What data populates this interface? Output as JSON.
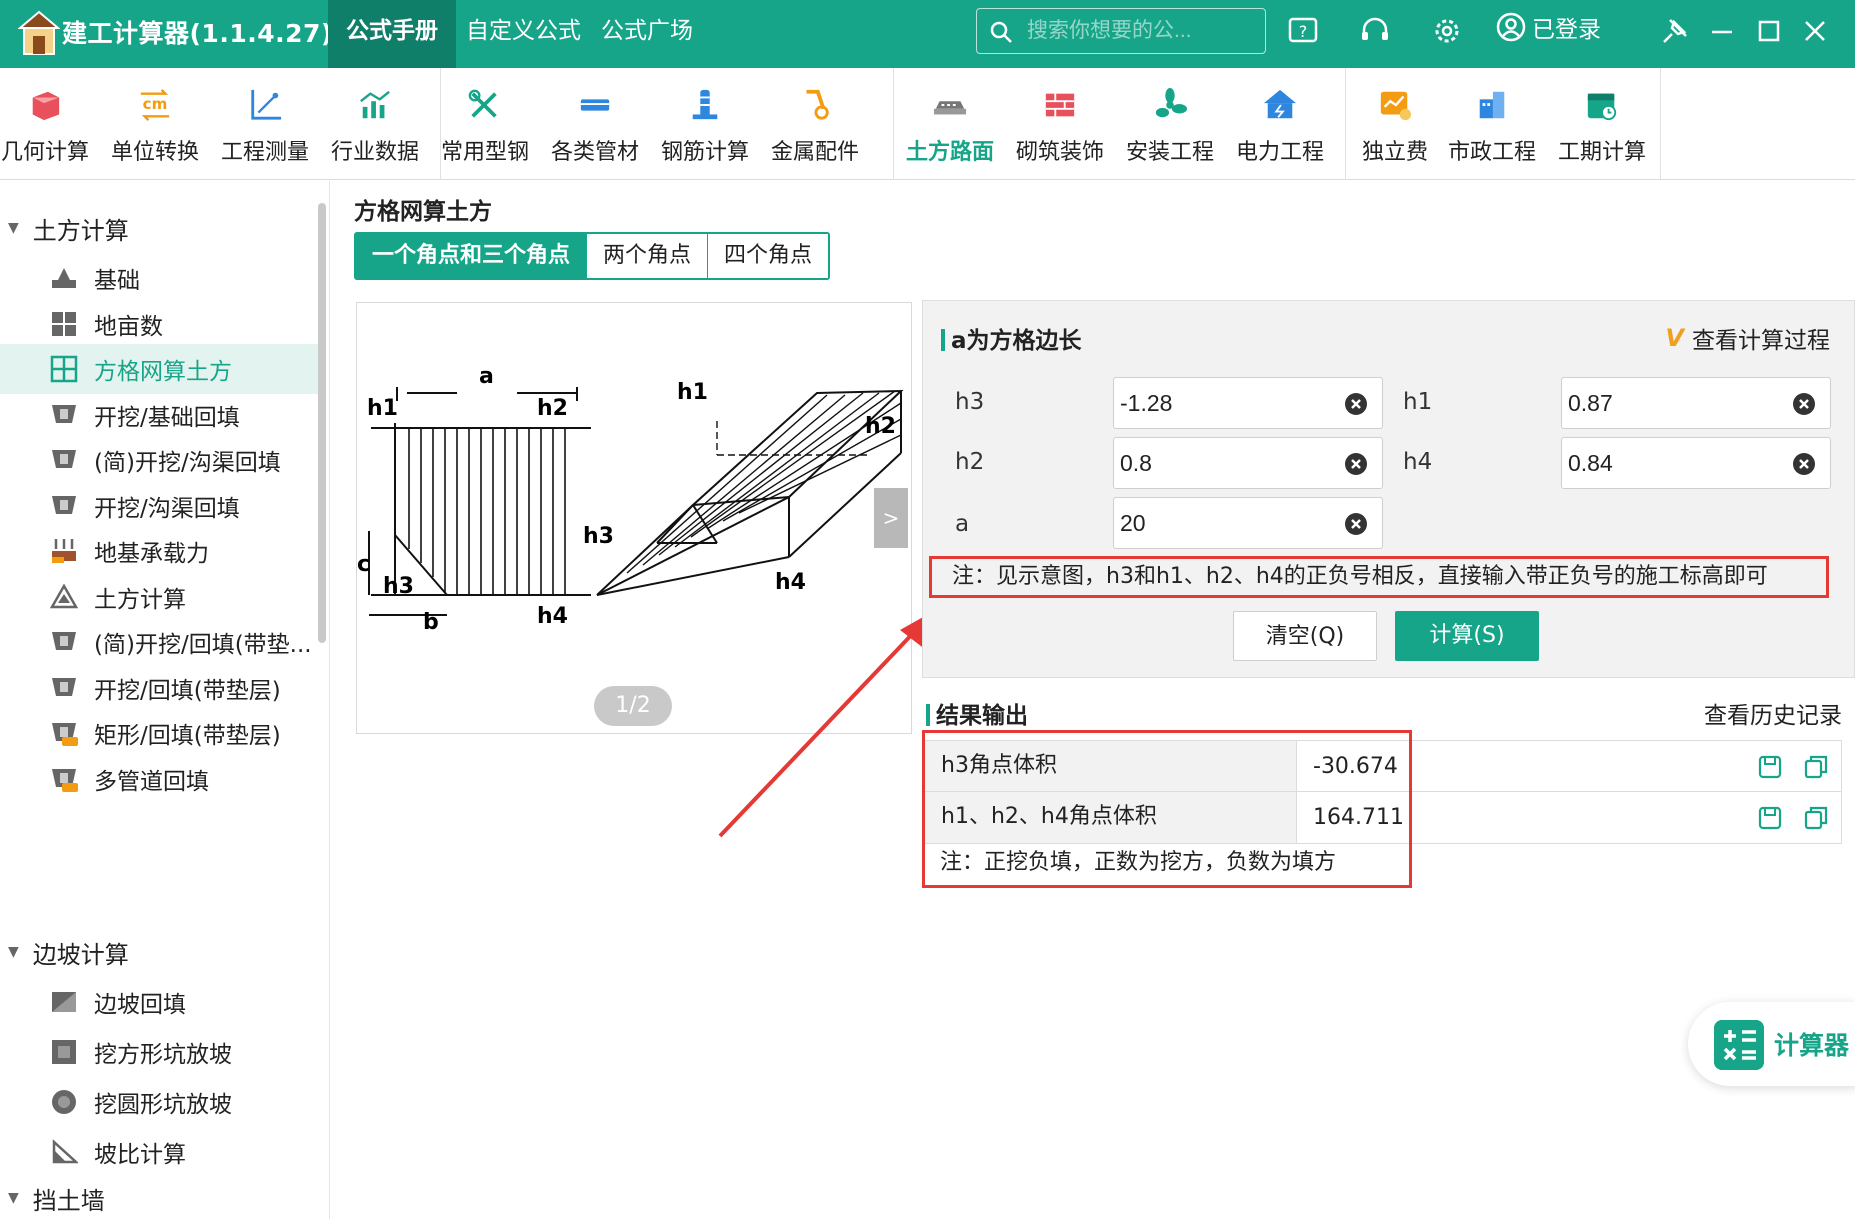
{
  "app": {
    "title": "建工计算器(1.1.4.27)"
  },
  "tabs": [
    {
      "label": "公式手册",
      "active": true
    },
    {
      "label": "自定义公式"
    },
    {
      "label": "公式广场"
    }
  ],
  "search": {
    "placeholder": "搜索你想要的公..."
  },
  "login": {
    "label": "已登录"
  },
  "ribbon": [
    {
      "label": "几何计算",
      "icon": "cube-icon",
      "color": "#e8505b"
    },
    {
      "label": "单位转换",
      "icon": "cm-convert-icon",
      "color": "#f39c12"
    },
    {
      "label": "工程测量",
      "icon": "axis-icon",
      "color": "#2e86de"
    },
    {
      "label": "行业数据",
      "icon": "chart-icon",
      "color": "#17a589"
    },
    {
      "label": "常用型钢",
      "icon": "tools-icon",
      "color": "#17a589"
    },
    {
      "label": "各类管材",
      "icon": "pipe-icon",
      "color": "#2e86de"
    },
    {
      "label": "钢筋计算",
      "icon": "rebar-icon",
      "color": "#2e86de"
    },
    {
      "label": "金属配件",
      "icon": "hook-icon",
      "color": "#f39c12"
    },
    {
      "label": "土方路面",
      "icon": "road-icon",
      "color": "#777777",
      "active": true
    },
    {
      "label": "砌筑装饰",
      "icon": "brick-icon",
      "color": "#e8505b"
    },
    {
      "label": "安装工程",
      "icon": "fan-icon",
      "color": "#17a589"
    },
    {
      "label": "电力工程",
      "icon": "power-house-icon",
      "color": "#2e86de"
    },
    {
      "label": "独立费",
      "icon": "fee-icon",
      "color": "#f39c12"
    },
    {
      "label": "市政工程",
      "icon": "city-icon",
      "color": "#2e86de"
    },
    {
      "label": "工期计算",
      "icon": "calendar-icon",
      "color": "#17a589"
    }
  ],
  "sidebar": {
    "groups": [
      {
        "label": "土方计算"
      },
      {
        "label": "边坡计算"
      },
      {
        "label": "挡土墙"
      }
    ],
    "items": [
      {
        "label": "基础"
      },
      {
        "label": "地亩数"
      },
      {
        "label": "方格网算土方",
        "active": true
      },
      {
        "label": "开挖/基础回填"
      },
      {
        "label": "(简)开挖/沟渠回填"
      },
      {
        "label": "开挖/沟渠回填"
      },
      {
        "label": "地基承载力"
      },
      {
        "label": "土方计算"
      },
      {
        "label": "(简)开挖/回填(带垫..."
      },
      {
        "label": "开挖/回填(带垫层)"
      },
      {
        "label": "矩形/回填(带垫层)"
      },
      {
        "label": "多管道回填"
      },
      {
        "label": "边坡回填"
      },
      {
        "label": "挖方形坑放坡"
      },
      {
        "label": "挖圆形坑放坡"
      },
      {
        "label": "坡比计算"
      }
    ]
  },
  "main": {
    "title": "方格网算土方",
    "subtabs": [
      {
        "label": "一个角点和三个角点",
        "active": true
      },
      {
        "label": "两个角点"
      },
      {
        "label": "四个角点"
      }
    ],
    "diagram": {
      "labels": {
        "a": "a",
        "b": "b",
        "c": "c",
        "h1": "h1",
        "h2": "h2",
        "h3": "h3",
        "h4": "h4"
      },
      "next": ">",
      "pager": "1/2"
    },
    "form": {
      "title": "a为方格边长",
      "view_process": "查看计算过程",
      "fields": {
        "h3": {
          "label": "h3",
          "value": "-1.28"
        },
        "h1": {
          "label": "h1",
          "value": "0.87"
        },
        "h2": {
          "label": "h2",
          "value": "0.8"
        },
        "h4": {
          "label": "h4",
          "value": "0.84"
        },
        "a": {
          "label": "a",
          "value": "20"
        }
      },
      "note": "注：见示意图，h3和h1、h2、h4的正负号相反，直接输入带正负号的施工标高即可",
      "clear_label": "清空(Q)",
      "calc_label": "计算(S)"
    },
    "results": {
      "title": "结果输出",
      "history": "查看历史记录",
      "rows": [
        {
          "label": "h3角点体积",
          "value": "-30.674"
        },
        {
          "label": "h1、h2、h4角点体积",
          "value": "164.711"
        }
      ],
      "note": "注：正挖负填，正数为挖方，负数为填方"
    }
  },
  "fab": {
    "label": "计算器"
  },
  "colors": {
    "primary": "#17a589",
    "highlight": "#e53935"
  }
}
